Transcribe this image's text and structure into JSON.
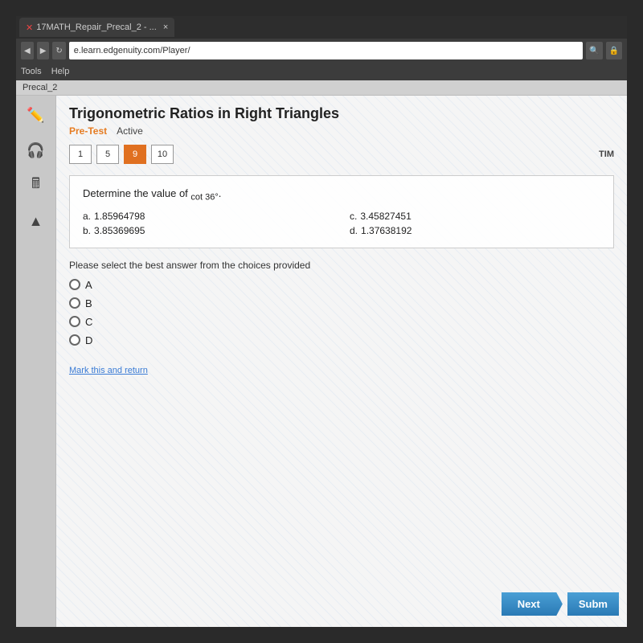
{
  "browser": {
    "address": "e.learn.edgenuity.com/Player/",
    "tab_title": "17MATH_Repair_Precal_2 - ...",
    "menu_tools": "Tools",
    "menu_help": "Help",
    "close_icon": "×"
  },
  "breadcrumb": "Precal_2",
  "lesson": {
    "title": "Trigonometric Ratios in Right Triangles",
    "pre_test": "Pre-Test",
    "status": "Active"
  },
  "question_nav": {
    "buttons": [
      "1",
      "5",
      "9",
      "10"
    ],
    "active_index": 2,
    "timer_label": "TIM"
  },
  "question": {
    "prompt": "Determine the value of cot 36°.",
    "cot_label": "cot 36°",
    "answers": [
      {
        "letter": "a.",
        "value": "1.85964798"
      },
      {
        "letter": "b.",
        "value": "3.85369695"
      },
      {
        "letter": "c.",
        "value": "3.45827451"
      },
      {
        "letter": "d.",
        "value": "1.37638192"
      }
    ]
  },
  "select_prompt": "Please select the best answer from the choices provided",
  "radio_options": [
    "A",
    "B",
    "C",
    "D"
  ],
  "mark_return": "Mark this and return",
  "buttons": {
    "next": "Next",
    "submit": "Subm"
  }
}
